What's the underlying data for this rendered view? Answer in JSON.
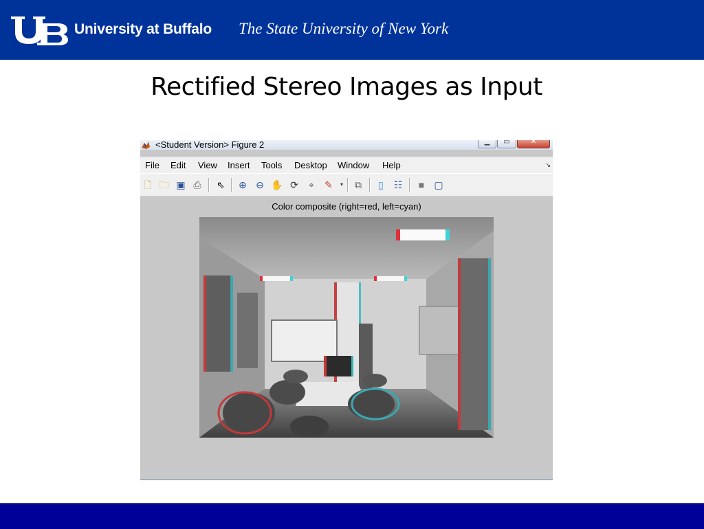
{
  "header": {
    "logo_text": "UB",
    "university_name": "University at Buffalo",
    "university_subtitle": "The State University of New York",
    "brand_color": "#003399"
  },
  "slide": {
    "title": "Rectified Stereo Images as Input"
  },
  "figure_window": {
    "title": "<Student Version> Figure 2",
    "window_buttons": [
      "minimize-icon",
      "maximize-icon",
      "close-icon"
    ],
    "menu": [
      "File",
      "Edit",
      "View",
      "Insert",
      "Tools",
      "Desktop",
      "Window",
      "Help"
    ],
    "toolbar_icons": [
      "new-figure-icon",
      "open-file-icon",
      "save-icon",
      "print-icon",
      "edit-plot-arrow-icon",
      "zoom-in-icon",
      "zoom-out-icon",
      "pan-hand-icon",
      "rotate-3d-icon",
      "data-cursor-icon",
      "brush-icon",
      "link-plot-icon",
      "colorbar-icon",
      "legend-icon",
      "hide-plot-tools-icon",
      "show-plot-tools-icon"
    ],
    "plot_title": "Color composite (right=red, left=cyan)"
  },
  "footer": {
    "bar_color": "#000099"
  }
}
